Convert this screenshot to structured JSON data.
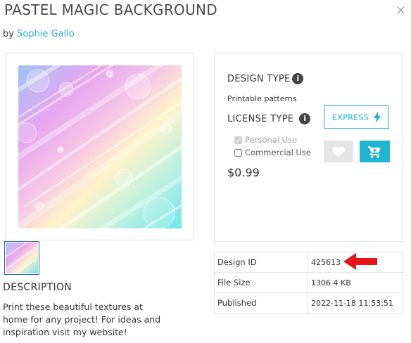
{
  "header": {
    "title": "PASTEL MAGIC BACKGROUND",
    "close_label": "×",
    "by_label": "by",
    "author": "Sophie Gallo"
  },
  "product": {
    "design_type_label": "DESIGN TYPE",
    "design_type_value": "Printable patterns",
    "license_type_label": "LICENSE TYPE",
    "info_glyph": "i",
    "express_label": "EXPRESS",
    "personal_use_label": "Personal Use",
    "personal_use_checked": true,
    "commercial_use_label": "Commercial Use",
    "commercial_use_checked": false,
    "price": "$0.99",
    "favorite_icon": "heart-icon",
    "cart_icon": "cart-icon",
    "express_icon": "lightning-icon"
  },
  "details": {
    "rows": [
      {
        "key": "Design ID",
        "value": "425613"
      },
      {
        "key": "File Size",
        "value": "1306.4 KB"
      },
      {
        "key": "Published",
        "value": "2022-11-18 11:53:51"
      }
    ]
  },
  "description": {
    "heading": "DESCRIPTION",
    "text": "Print these beautiful textures at home for any project! For ideas and inspiration visit my website!"
  },
  "colors": {
    "accent": "#21b4cf",
    "annotation_arrow": "#e8141c"
  }
}
